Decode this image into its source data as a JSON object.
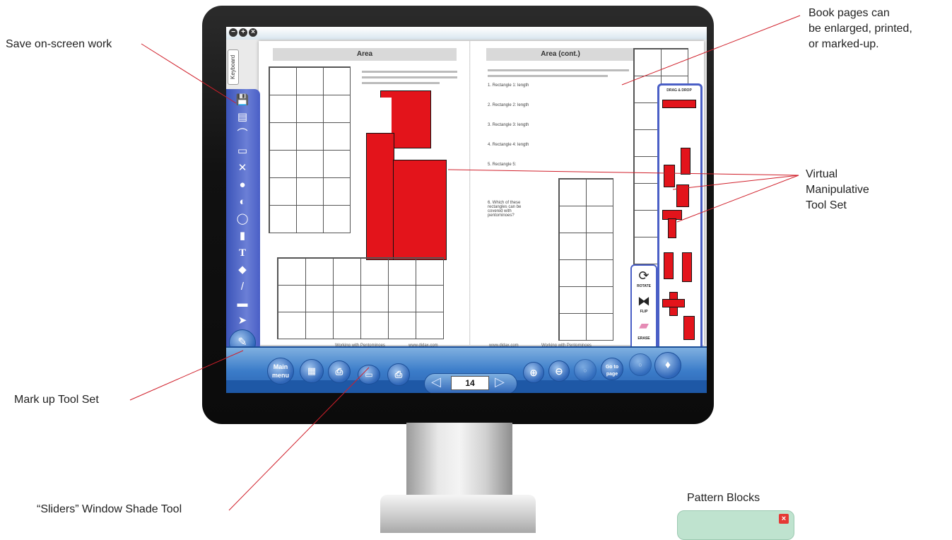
{
  "callouts": {
    "save_work": "Save on-screen work",
    "book_pages": [
      "Book pages can",
      "be enlarged, printed,",
      "or marked-up."
    ],
    "virtual_manipulative": [
      "Virtual",
      "Manipulative",
      "Tool Set"
    ],
    "markup_toolset": "Mark up Tool Set",
    "sliders": "“Sliders” Window Shade Tool",
    "pattern_blocks": "Pattern Blocks"
  },
  "app": {
    "keyboard_tab": "Keyboard",
    "left_page": {
      "title": "Area",
      "footer_center": "Working with Pentominoes",
      "footer_right": "www.didax.com"
    },
    "right_page": {
      "title": "Area (cont.)",
      "items": [
        "1. Rectangle 1: length",
        "2. Rectangle 2: length",
        "3. Rectangle 3: length",
        "4. Rectangle 4: length",
        "5. Rectangle 5:",
        "6. Which of these rectangles can be covered with pentominoes?"
      ],
      "footer_left": "www.didax.com",
      "footer_center": "Working with Pentominoes"
    },
    "manipulative_title": "DRAG & DROP",
    "actions": {
      "rotate": "ROTATE",
      "flip": "FLIP",
      "erase": "ERASE"
    },
    "bottom": {
      "main_menu": "Main menu",
      "page_number": "14",
      "page_jump": "Go to page"
    }
  },
  "colors": {
    "accent_blue": "#3b54b8",
    "pentomino_red": "#e3141b",
    "bar_blue": "#3b7cc9"
  },
  "icons": [
    "save-icon",
    "print-icon",
    "zoom-in-icon",
    "zoom-out-icon",
    "rotate-icon",
    "flip-icon",
    "eraser-icon",
    "close-icon"
  ]
}
